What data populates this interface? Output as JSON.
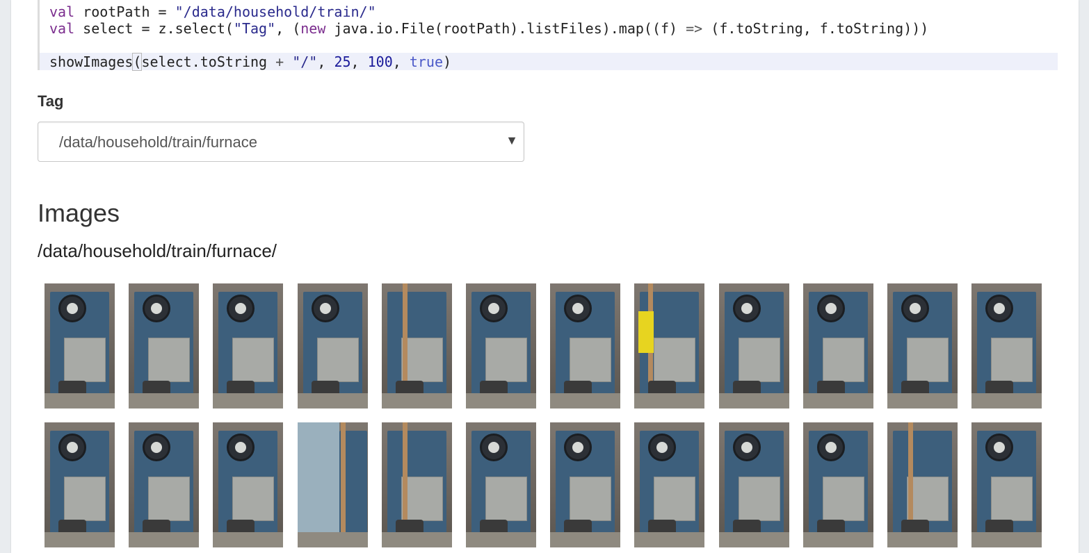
{
  "editor": {
    "lines": [
      {
        "parts": [
          {
            "t": "val",
            "c": "kw"
          },
          {
            "t": " rootPath = ",
            "c": ""
          },
          {
            "t": "\"/data/household/train/\"",
            "c": "str"
          }
        ]
      },
      {
        "parts": [
          {
            "t": "val",
            "c": "kw"
          },
          {
            "t": " select = z.select(",
            "c": ""
          },
          {
            "t": "\"Tag\"",
            "c": "str"
          },
          {
            "t": ", (",
            "c": ""
          },
          {
            "t": "new",
            "c": "kw"
          },
          {
            "t": " java.io.File(rootPath).listFiles).map((f) ",
            "c": ""
          },
          {
            "t": "=>",
            "c": "op"
          },
          {
            "t": " (f.toString, f.toString)))",
            "c": ""
          }
        ]
      },
      {
        "parts": [
          {
            "t": "",
            "c": ""
          }
        ]
      },
      {
        "parts": [
          {
            "t": "showImages",
            "c": ""
          },
          {
            "t": "(",
            "c": "cursor-bracket"
          },
          {
            "t": "select.toString ",
            "c": ""
          },
          {
            "t": "+",
            "c": "op"
          },
          {
            "t": " ",
            "c": ""
          },
          {
            "t": "\"/\"",
            "c": "str"
          },
          {
            "t": ", ",
            "c": ""
          },
          {
            "t": "25",
            "c": "num"
          },
          {
            "t": ", ",
            "c": ""
          },
          {
            "t": "100",
            "c": "num"
          },
          {
            "t": ", ",
            "c": ""
          },
          {
            "t": "true",
            "c": "bool"
          },
          {
            "t": ")",
            "c": ""
          }
        ]
      }
    ]
  },
  "form": {
    "tag_label": "Tag",
    "selected_value": "/data/household/train/furnace",
    "caret": "▼"
  },
  "output": {
    "heading": "Images",
    "path": "/data/household/train/furnace/",
    "thumbnails": [
      "furnace-photo-1",
      "furnace-photo-2",
      "furnace-photo-3",
      "furnace-photo-4",
      "furnace-photo-5",
      "furnace-photo-6",
      "furnace-photo-7",
      "furnace-photo-8",
      "furnace-photo-9",
      "furnace-photo-10",
      "furnace-photo-11",
      "furnace-photo-12",
      "furnace-photo-13",
      "furnace-photo-14",
      "furnace-photo-15",
      "furnace-photo-16",
      "furnace-photo-17",
      "furnace-photo-18",
      "furnace-photo-19",
      "furnace-photo-20",
      "furnace-photo-21",
      "furnace-photo-22",
      "furnace-photo-23",
      "furnace-photo-24"
    ]
  },
  "colors": {
    "furnace_blue": "#3d5f7c",
    "plate_gray": "#a8aaa6",
    "copper_pipe": "#b48a5e",
    "warning_yellow": "#e7d420"
  }
}
